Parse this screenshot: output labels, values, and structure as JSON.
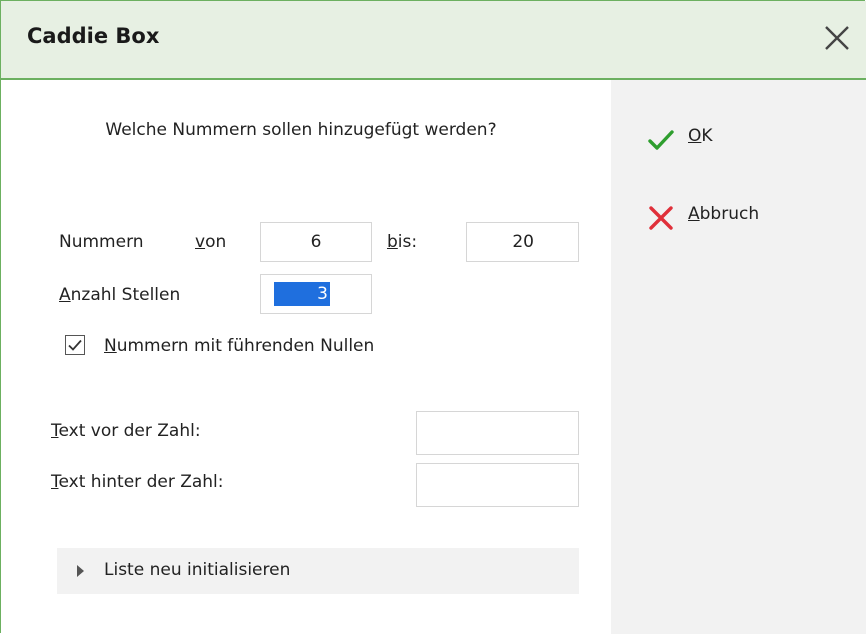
{
  "window": {
    "title": "Caddie Box"
  },
  "question": "Welche Nummern sollen hinzugefügt werden?",
  "range": {
    "label": "Nummern",
    "from_label_mnemonic": "v",
    "from_label_rest": "on",
    "from_value": "6",
    "to_label_mnemonic": "b",
    "to_label_rest": "is:",
    "to_value": "20"
  },
  "digits": {
    "label_mnemonic": "A",
    "label_rest": "nzahl Stellen",
    "value": "3"
  },
  "leading_zeros": {
    "label_mnemonic": "N",
    "label_rest": "ummern mit führenden Nullen",
    "checked": true
  },
  "prefix": {
    "label_mnemonic": "T",
    "label_rest": "ext vor der Zahl:",
    "value": ""
  },
  "suffix": {
    "label_mnemonic": "T",
    "label_rest": "ext hinter der Zahl:",
    "value": ""
  },
  "expander": {
    "label": "Liste neu initialisieren"
  },
  "buttons": {
    "ok": {
      "mnemonic": "O",
      "rest": "K",
      "icon": "checkmark-icon",
      "color": "#2e9e2e"
    },
    "cancel": {
      "mnemonic": "A",
      "rest": "bbruch",
      "icon": "x-icon",
      "color": "#e0303a"
    }
  },
  "colors": {
    "accent": "#6cb060",
    "titlebar_bg": "#e7f0e3",
    "selection": "#1f6fde"
  }
}
